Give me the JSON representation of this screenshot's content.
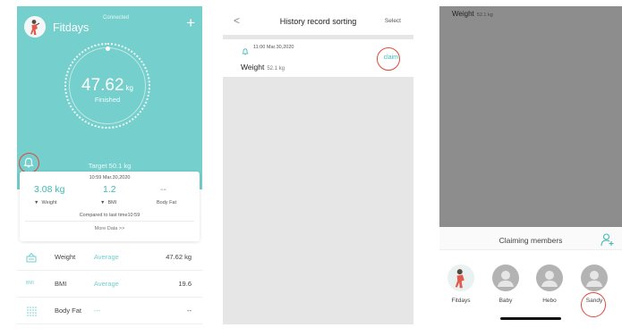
{
  "screen1": {
    "app_name": "Fitdays",
    "connection_status": "Connected",
    "add_symbol": "+",
    "weight_value": "47.62",
    "weight_unit": "kg",
    "measure_status": "Finished",
    "target_text": "Target 50.1 kg",
    "card": {
      "time": "10:59 Mar.30,2020",
      "changes": [
        {
          "value": "3.08 kg",
          "label": "Weight",
          "arrow": "▼"
        },
        {
          "value": "1.2",
          "label": "BMI",
          "arrow": "▼"
        },
        {
          "value": "--",
          "label": "Body Fat",
          "arrow": ""
        }
      ],
      "compare_text": "Compared to last time10:59",
      "more_link": "More Data >>"
    },
    "metrics": [
      {
        "icon": "scale-icon",
        "name": "Weight",
        "status": "Average",
        "value": "47.62 kg"
      },
      {
        "icon_text": "BMI",
        "name": "BMI",
        "status": "Average",
        "value": "19.6"
      },
      {
        "icon": "body-fat-icon",
        "name": "Body Fat",
        "status": "---",
        "value": "--"
      }
    ],
    "colors": {
      "accent": "#74cfcd",
      "highlight": "#e0493b"
    }
  },
  "screen2": {
    "back_symbol": "<",
    "title": "History record sorting",
    "select_label": "Select",
    "record": {
      "time": "11:00 Mar.30,2020",
      "label": "Weight",
      "value": "52.1 kg",
      "claim_label": "claim"
    }
  },
  "screen3": {
    "record_label": "Weight",
    "record_value": "52.1 kg",
    "sheet_title": "Claiming members",
    "members": [
      {
        "name": "Fitdays",
        "avatar": "user-photo"
      },
      {
        "name": "Baby",
        "avatar": "default-avatar-icon"
      },
      {
        "name": "Hebo",
        "avatar": "default-avatar-icon"
      },
      {
        "name": "Sandy",
        "avatar": "default-avatar-icon"
      }
    ]
  }
}
